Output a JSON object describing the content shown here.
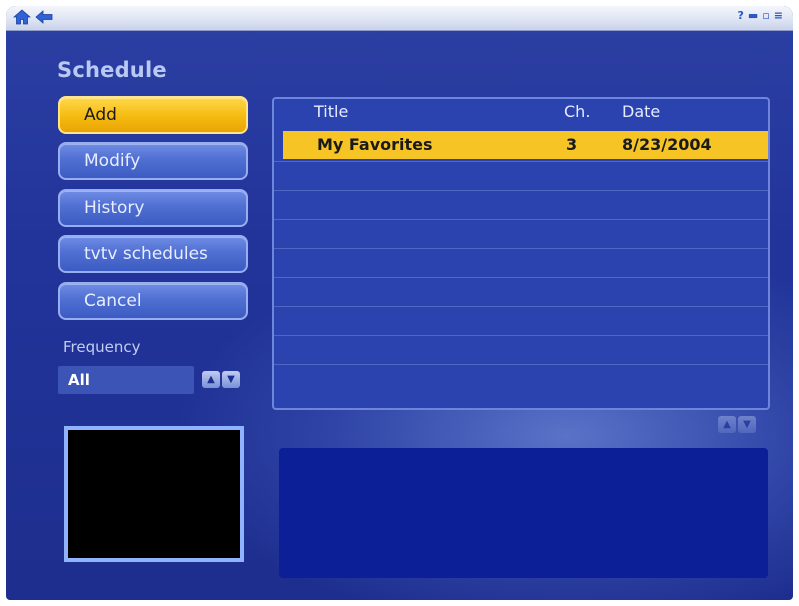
{
  "titlebar": {
    "home_icon": "home-icon",
    "back_icon": "back-arrow-icon",
    "help_glyph": "?",
    "minimize_glyph": "▬",
    "restore_glyph": "▫",
    "close_glyph": "≡"
  },
  "page": {
    "title": "Schedule"
  },
  "actions": [
    {
      "label": "Add",
      "selected": true
    },
    {
      "label": "Modify",
      "selected": false
    },
    {
      "label": "History",
      "selected": false
    },
    {
      "label": "tvtv schedules",
      "selected": false
    },
    {
      "label": "Cancel",
      "selected": false
    }
  ],
  "frequency": {
    "label": "Frequency",
    "value": "All"
  },
  "list": {
    "columns": [
      "Title",
      "Ch.",
      "Date"
    ],
    "rows": [
      {
        "title": "My Favorites",
        "channel": "3",
        "date": "8/23/2004",
        "selected": true
      }
    ]
  },
  "colors": {
    "accent": "#f6c525",
    "background": "#22349a",
    "button": "#4f6fd2"
  }
}
